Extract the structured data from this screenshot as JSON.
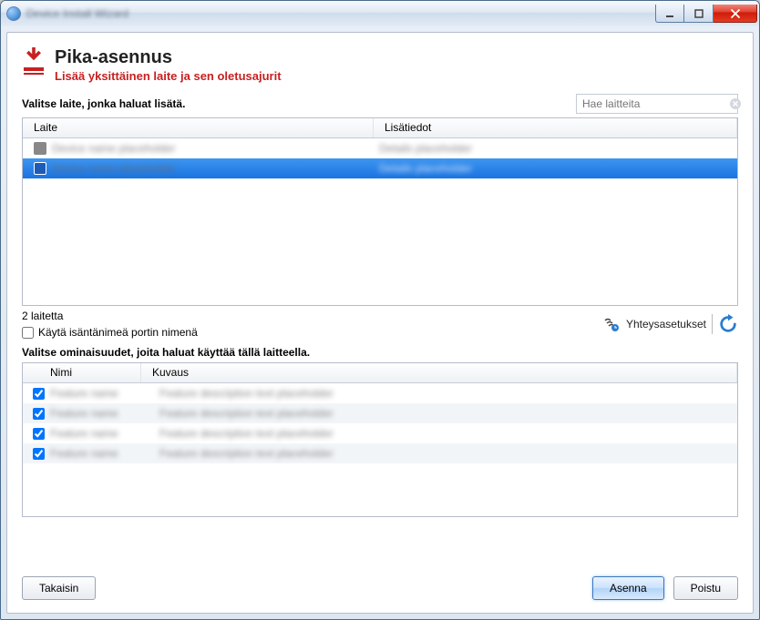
{
  "window": {
    "title": "Device Install Wizard"
  },
  "header": {
    "title": "Pika-asennus",
    "subtitle": "Lisää yksittäinen laite ja sen oletusajurit"
  },
  "search": {
    "placeholder": "Hae laitteita",
    "value": ""
  },
  "devices": {
    "label_select": "Valitse laite, jonka haluat lisätä.",
    "col_device": "Laite",
    "col_details": "Lisätiedot",
    "rows": [
      {
        "name": "Device name placeholder",
        "details": "Details placeholder",
        "selected": false
      },
      {
        "name": "Device name placeholder",
        "details": "Details placeholder",
        "selected": true
      }
    ],
    "count_text": "2 laitetta",
    "use_host_port_label": "Käytä isäntänimeä portin nimenä"
  },
  "comm": {
    "settings_label": "Yhteysasetukset"
  },
  "features": {
    "label_select": "Valitse ominaisuudet, joita haluat käyttää tällä laitteella.",
    "col_name": "Nimi",
    "col_desc": "Kuvaus",
    "rows": [
      {
        "checked": true,
        "name": "Feature name",
        "desc": "Feature description text placeholder"
      },
      {
        "checked": true,
        "name": "Feature name",
        "desc": "Feature description text placeholder"
      },
      {
        "checked": true,
        "name": "Feature name",
        "desc": "Feature description text placeholder"
      },
      {
        "checked": true,
        "name": "Feature name",
        "desc": "Feature description text placeholder"
      }
    ]
  },
  "buttons": {
    "back": "Takaisin",
    "install": "Asenna",
    "exit": "Poistu"
  }
}
